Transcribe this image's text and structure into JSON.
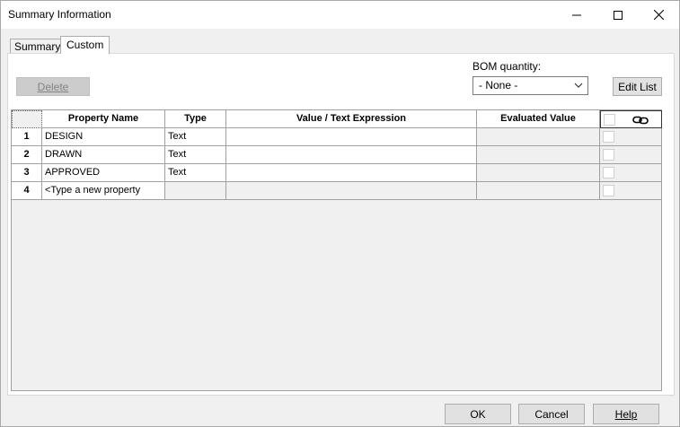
{
  "window": {
    "title": "Summary Information",
    "min_glyph": "—",
    "max_glyph": "☐",
    "close_glyph": "✕"
  },
  "tabs": [
    {
      "label": "Summary",
      "active": false
    },
    {
      "label": "Custom",
      "active": true
    }
  ],
  "toolbar": {
    "delete_label": "Delete",
    "bom_label": "BOM quantity:",
    "bom_value": "- None -",
    "edit_list_label": "Edit List"
  },
  "table": {
    "columns": [
      "Property Name",
      "Type",
      "Value / Text Expression",
      "Evaluated Value"
    ],
    "link_icon": "link-icon",
    "rows": [
      {
        "num": "1",
        "name": "DESIGN",
        "type": "Text",
        "value": "",
        "evaluated": ""
      },
      {
        "num": "2",
        "name": "DRAWN",
        "type": "Text",
        "value": "",
        "evaluated": ""
      },
      {
        "num": "3",
        "name": "APPROVED",
        "type": "Text",
        "value": "",
        "evaluated": ""
      },
      {
        "num": "4",
        "name": "<Type a new property",
        "type": "",
        "value": "",
        "evaluated": ""
      }
    ]
  },
  "footer": {
    "ok_label": "OK",
    "cancel_label": "Cancel",
    "help_label": "Help"
  }
}
